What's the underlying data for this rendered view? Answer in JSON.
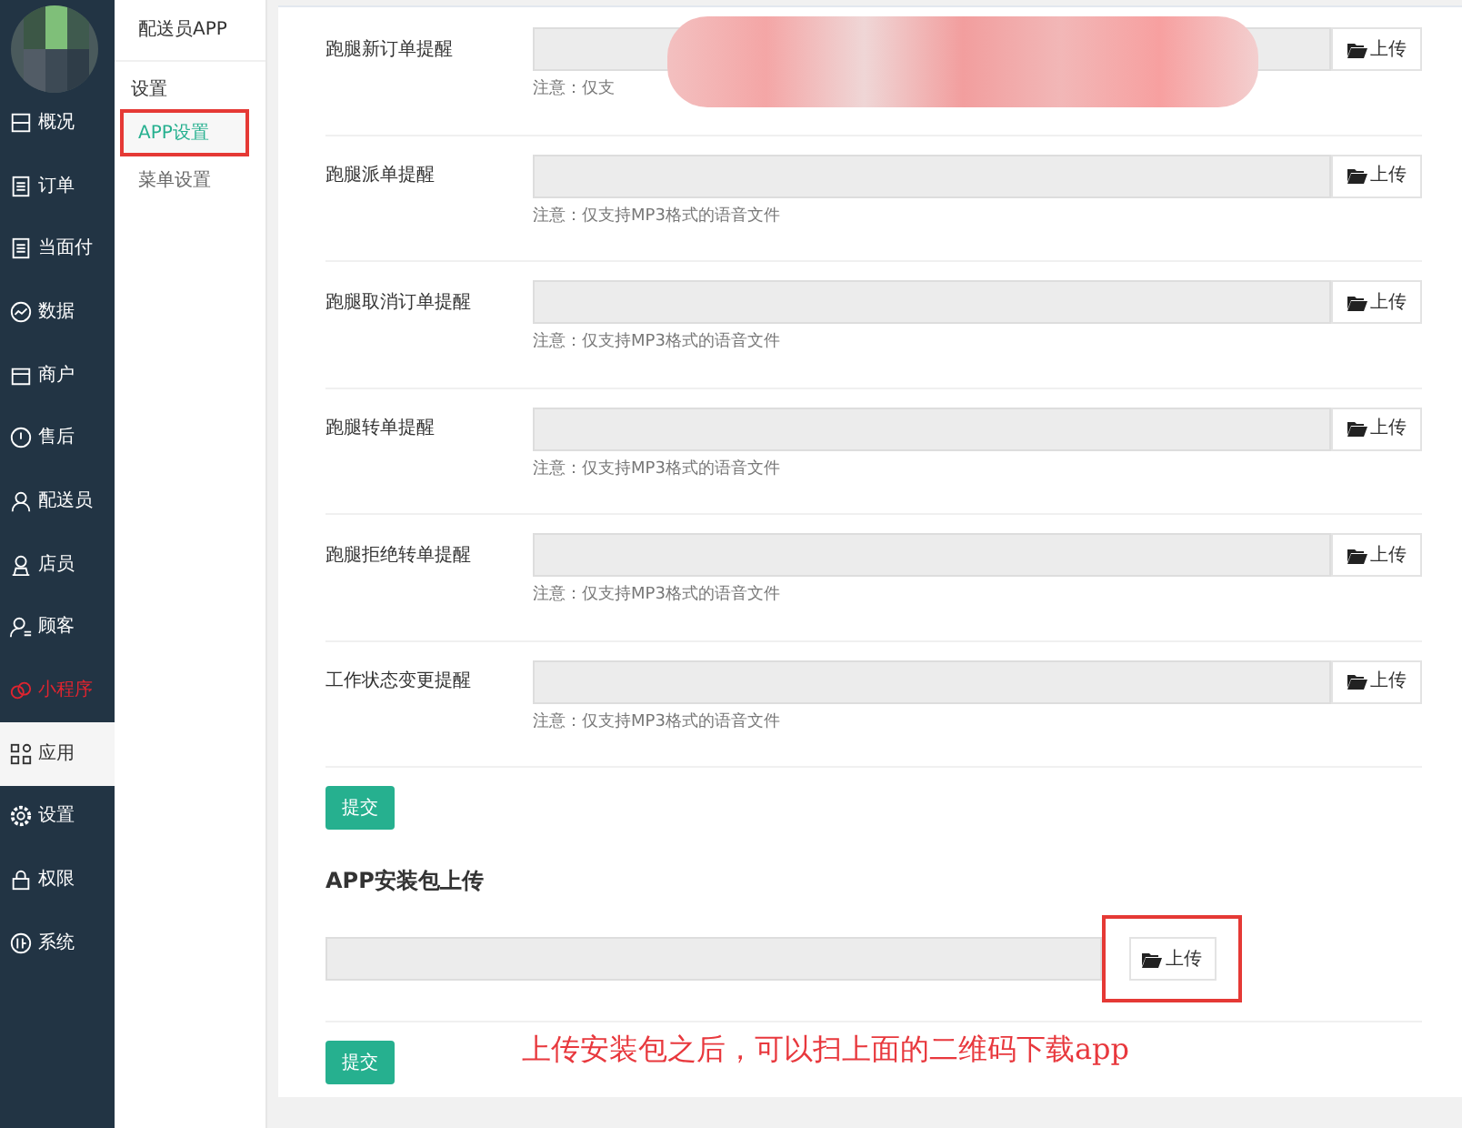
{
  "nav": [
    {
      "label": "概况",
      "selected": false,
      "color": "#ffffff"
    },
    {
      "label": "订单",
      "selected": false,
      "color": "#ffffff"
    },
    {
      "label": "当面付",
      "selected": false,
      "color": "#ffffff"
    },
    {
      "label": "数据",
      "selected": false,
      "color": "#ffffff"
    },
    {
      "label": "商户",
      "selected": false,
      "color": "#ffffff"
    },
    {
      "label": "售后",
      "selected": false,
      "color": "#ffffff"
    },
    {
      "label": "配送员",
      "selected": false,
      "color": "#ffffff"
    },
    {
      "label": "店员",
      "selected": false,
      "color": "#ffffff"
    },
    {
      "label": "顾客",
      "selected": false,
      "color": "#ffffff"
    },
    {
      "label": "小程序",
      "selected": false,
      "color": "#e0242f"
    },
    {
      "label": "应用",
      "selected": true,
      "color": "#333333"
    },
    {
      "label": "设置",
      "selected": false,
      "color": "#ffffff"
    },
    {
      "label": "权限",
      "selected": false,
      "color": "#ffffff"
    },
    {
      "label": "系统",
      "selected": false,
      "color": "#ffffff"
    }
  ],
  "subnav": {
    "title": "配送员APP",
    "group": "设置",
    "items": [
      {
        "label": "APP设置",
        "selected": true,
        "annotated": true
      },
      {
        "label": "菜单设置",
        "selected": false,
        "annotated": false
      }
    ]
  },
  "sounds": [
    {
      "label": "跑腿新订单提醒",
      "note": "注意：仅支",
      "button": "上传",
      "redacted": true
    },
    {
      "label": "跑腿派单提醒",
      "note": "注意：仅支持MP3格式的语音文件",
      "button": "上传",
      "redacted": false
    },
    {
      "label": "跑腿取消订单提醒",
      "note": "注意：仅支持MP3格式的语音文件",
      "button": "上传",
      "redacted": false
    },
    {
      "label": "跑腿转单提醒",
      "note": "注意：仅支持MP3格式的语音文件",
      "button": "上传",
      "redacted": false
    },
    {
      "label": "跑腿拒绝转单提醒",
      "note": "注意：仅支持MP3格式的语音文件",
      "button": "上传",
      "redacted": false
    },
    {
      "label": "工作状态变更提醒",
      "note": "注意：仅支持MP3格式的语音文件",
      "button": "上传",
      "redacted": false
    }
  ],
  "submit_1": "提交",
  "package": {
    "title": "APP安装包上传",
    "button": "上传",
    "annotated": true
  },
  "submit_2": "提交",
  "annotation_text": "上传安装包之后，可以扫上面的二维码下载app"
}
